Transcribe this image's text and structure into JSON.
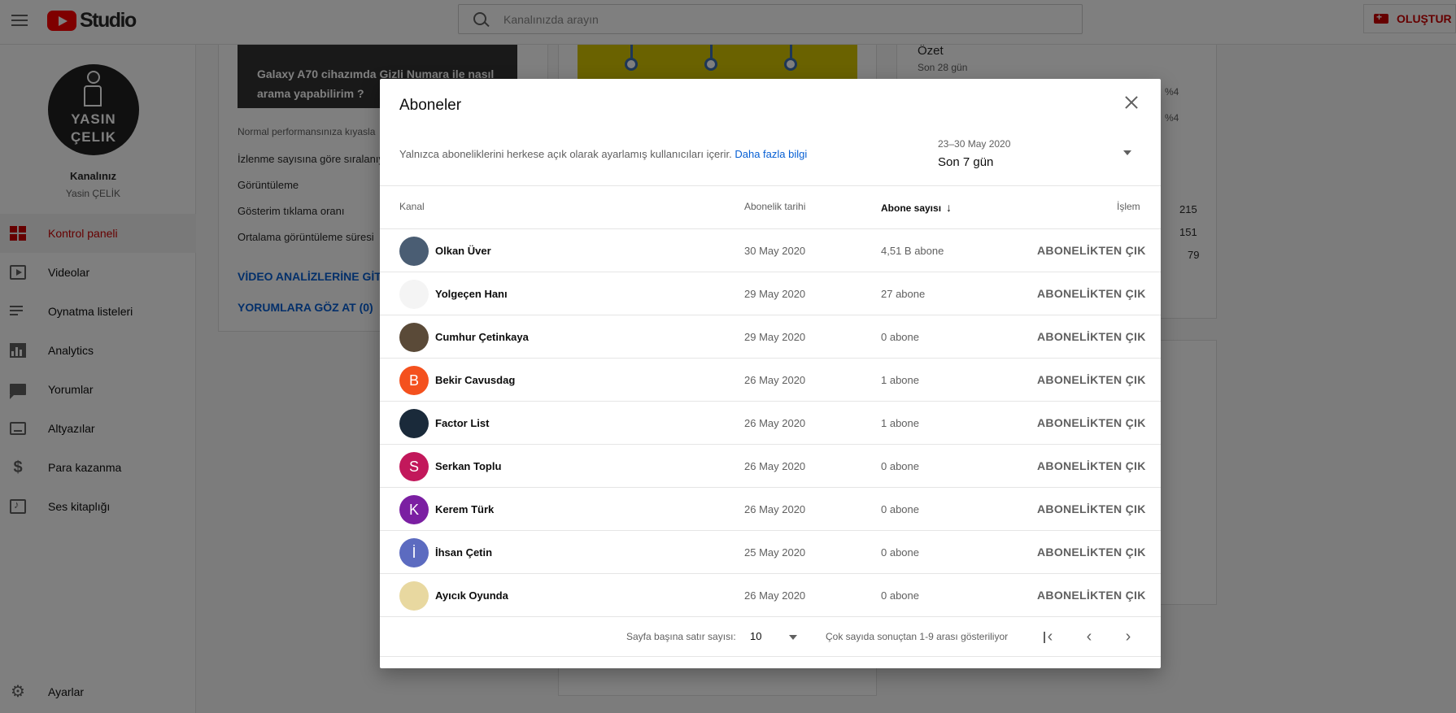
{
  "header": {
    "logo_text": "Studio",
    "search_placeholder": "Kanalınızda arayın",
    "create_label": "OLUŞTUR"
  },
  "sidebar": {
    "avatar_line1": "YASIN",
    "avatar_line2": "ÇELIK",
    "channel_label": "Kanalınız",
    "channel_name": "Yasin ÇELİK",
    "items": [
      {
        "label": "Kontrol paneli",
        "icon": "dashboard-icon",
        "active": true
      },
      {
        "label": "Videolar",
        "icon": "videos-icon"
      },
      {
        "label": "Oynatma listeleri",
        "icon": "playlists-icon"
      },
      {
        "label": "Analytics",
        "icon": "analytics-icon"
      },
      {
        "label": "Yorumlar",
        "icon": "comments-icon"
      },
      {
        "label": "Altyazılar",
        "icon": "subtitles-icon"
      },
      {
        "label": "Para kazanma",
        "icon": "monetization-icon"
      },
      {
        "label": "Ses kitaplığı",
        "icon": "audio-library-icon"
      }
    ],
    "settings_label": "Ayarlar"
  },
  "background": {
    "video_title": "Galaxy A70 cihazımda Gizli Numara ile nasıl arama yapabilirim ?",
    "perf_text": "Normal performansınıza kıyasla",
    "rank_text": "İzlenme sayısına göre sıralanıyor",
    "metric_views": "Görüntüleme",
    "metric_ctr": "Gösterim tıklama oranı",
    "metric_avg": "Ortalama görüntüleme süresi",
    "link_analytics": "VİDEO ANALİZLERİNE GİT",
    "link_comments": "YORUMLARA GÖZ AT (0)",
    "summary_title": "Özet",
    "summary_period": "Son 28 gün",
    "pct_1": "%4",
    "pct_2": "%4",
    "num_1": "215",
    "num_2": "151",
    "num_3": "79"
  },
  "modal": {
    "title": "Aboneler",
    "info_text": "Yalnızca aboneliklerini herkese açık olarak ayarlamış kullanıcıları içerir.",
    "info_link": "Daha fazla bilgi",
    "date_range": "23–30 May 2020",
    "period": "Son 7 gün",
    "columns": {
      "channel": "Kanal",
      "subscribed_date": "Abonelik tarihi",
      "subscriber_count": "Abone sayısı",
      "action": "İşlem"
    },
    "rows": [
      {
        "name": "Olkan Üver",
        "date": "30 May 2020",
        "count": "4,51 B abone",
        "action": "ABONELİKTEN ÇIK",
        "avatar_letter": "",
        "avatar_color": "#4a5d73"
      },
      {
        "name": "Yolgeçen Hanı",
        "date": "29 May 2020",
        "count": "27 abone",
        "action": "ABONELİKTEN ÇIK",
        "avatar_letter": "",
        "avatar_color": "#f4f4f4"
      },
      {
        "name": "Cumhur Çetinkaya",
        "date": "29 May 2020",
        "count": "0 abone",
        "action": "ABONELİKTEN ÇIK",
        "avatar_letter": "",
        "avatar_color": "#5a4a38"
      },
      {
        "name": "Bekir Cavusdag",
        "date": "26 May 2020",
        "count": "1 abone",
        "action": "ABONELİKTEN ÇIK",
        "avatar_letter": "B",
        "avatar_color": "#f4511e"
      },
      {
        "name": "Factor List",
        "date": "26 May 2020",
        "count": "1 abone",
        "action": "ABONELİKTEN ÇIK",
        "avatar_letter": "",
        "avatar_color": "#1a2a3a"
      },
      {
        "name": "Serkan Toplu",
        "date": "26 May 2020",
        "count": "0 abone",
        "action": "ABONELİKTEN ÇIK",
        "avatar_letter": "S",
        "avatar_color": "#c2185b"
      },
      {
        "name": "Kerem Türk",
        "date": "26 May 2020",
        "count": "0 abone",
        "action": "ABONELİKTEN ÇIK",
        "avatar_letter": "K",
        "avatar_color": "#7b1fa2"
      },
      {
        "name": "İhsan Çetin",
        "date": "25 May 2020",
        "count": "0 abone",
        "action": "ABONELİKTEN ÇIK",
        "avatar_letter": "İ",
        "avatar_color": "#5c6bc0"
      },
      {
        "name": "Ayıcık Oyunda",
        "date": "26 May 2020",
        "count": "0 abone",
        "action": "ABONELİKTEN ÇIK",
        "avatar_letter": "",
        "avatar_color": "#e8d8a0"
      }
    ],
    "footer": {
      "rows_per_page_label": "Sayfa başına satır sayısı:",
      "rows_per_page": "10",
      "range_text": "Çok sayıda sonuçtan 1-9 arası gösteriliyor"
    }
  },
  "colors": {
    "accent": "#cc0000",
    "link": "#065fd4"
  }
}
